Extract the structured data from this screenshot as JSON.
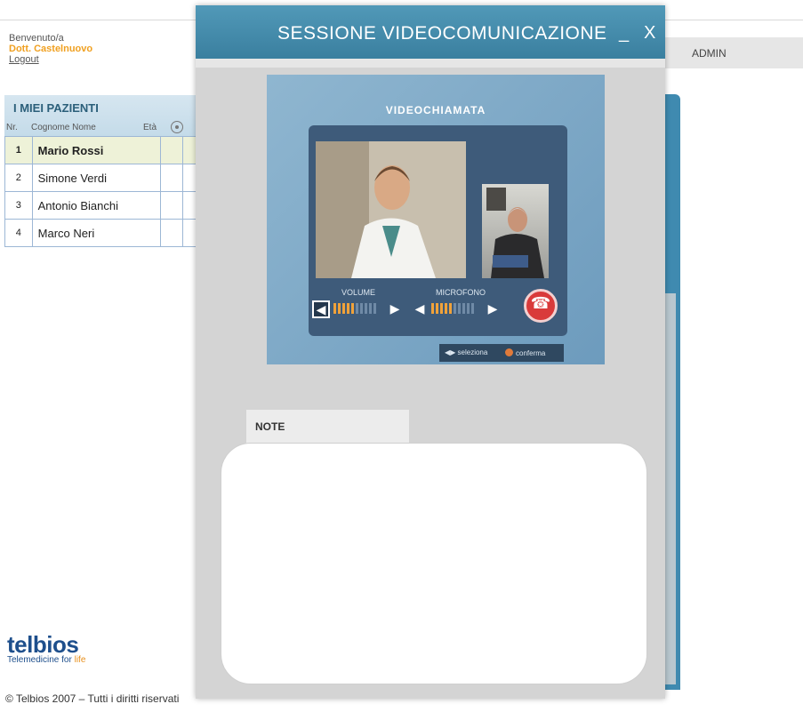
{
  "header": {
    "welcome": "Benvenuto/a",
    "doctor": "Dott. Castelnuovo",
    "logout": "Logout",
    "admin": "ADMIN"
  },
  "patients": {
    "title": "I MIEI PAZIENTI",
    "columns": {
      "nr": "Nr.",
      "name": "Cognome Nome",
      "age": "Età"
    },
    "rows": [
      {
        "nr": "1",
        "name": "Mario Rossi",
        "selected": true
      },
      {
        "nr": "2",
        "name": "Simone Verdi"
      },
      {
        "nr": "3",
        "name": "Antonio Bianchi"
      },
      {
        "nr": "4",
        "name": "Marco Neri"
      }
    ],
    "target_icon": "target-icon"
  },
  "logo": {
    "name": "telbios",
    "tagline_a": "Telemedicine for ",
    "tagline_b": "life"
  },
  "footer": {
    "copyright": "© Telbios 2007 – Tutti i diritti riservati"
  },
  "modal": {
    "title": "SESSIONE VIDEOCOMUNICAZIONE",
    "minimize": "_",
    "close": "X",
    "video": {
      "title": "VIDEOCHIAMATA",
      "volume_label": "VOLUME",
      "mic_label": "MICROFONO",
      "volume_level": 0.5,
      "mic_level": 0.5,
      "hint_select": "◀▶ seleziona",
      "hint_confirm": "conferma"
    },
    "note_label": "NOTE",
    "note_value": ""
  },
  "colors": {
    "accent": "#3f8ab0",
    "brand_orange": "#f0a020",
    "hangup": "#d93a3a"
  }
}
